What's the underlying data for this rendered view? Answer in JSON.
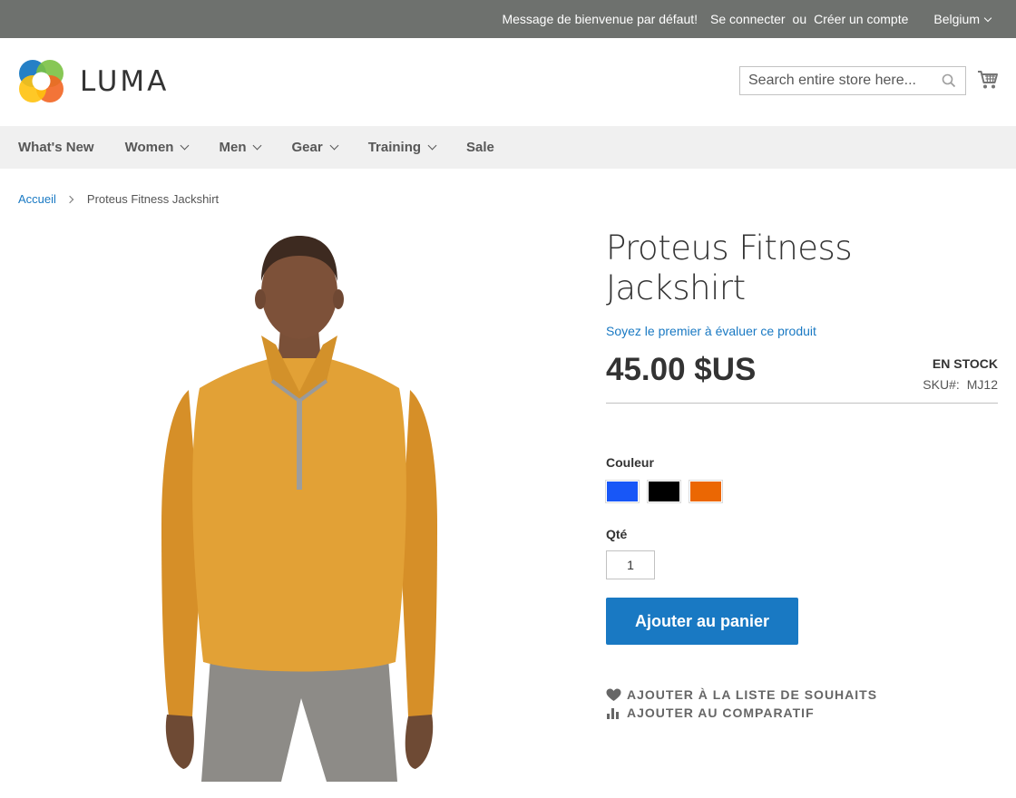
{
  "topbar": {
    "welcome": "Message de bienvenue par défaut!",
    "sign_in": "Se connecter",
    "or": "ou",
    "create_account": "Créer un compte",
    "store": "Belgium"
  },
  "header": {
    "logo_text": "LUMA",
    "search_placeholder": "Search entire store here...",
    "icons": [
      "luma-logo",
      "search-icon",
      "cart-icon"
    ]
  },
  "nav": {
    "items": [
      {
        "label": "What's New",
        "dropdown": false
      },
      {
        "label": "Women",
        "dropdown": true
      },
      {
        "label": "Men",
        "dropdown": true
      },
      {
        "label": "Gear",
        "dropdown": true
      },
      {
        "label": "Training",
        "dropdown": true
      },
      {
        "label": "Sale",
        "dropdown": false
      }
    ]
  },
  "breadcrumb": {
    "home": "Accueil",
    "current": "Proteus Fitness Jackshirt"
  },
  "product": {
    "title": "Proteus Fitness Jackshirt",
    "review_link": "Soyez le premier à évaluer ce produit",
    "price": "45.00 $US",
    "stock": "EN STOCK",
    "sku_label": "SKU#:",
    "sku_value": "MJ12",
    "color_label": "Couleur",
    "colors": [
      "#1857f7",
      "#000000",
      "#eb6703"
    ],
    "qty_label": "Qté",
    "qty_value": "1",
    "add_to_cart": "Ajouter au panier",
    "wishlist": "AJOUTER À LA LISTE DE SOUHAITS",
    "compare": "AJOUTER AU COMPARATIF"
  },
  "colors": {
    "topbar_bg": "#6e716e",
    "accent": "#1979c3",
    "nav_bg": "#f0f0f0"
  }
}
